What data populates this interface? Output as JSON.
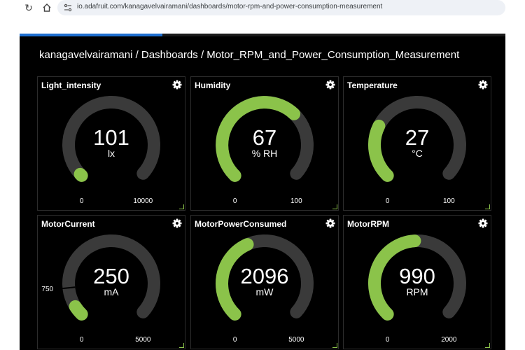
{
  "browser": {
    "url": "io.adafruit.com/kanagavelvairamani/dashboards/motor-rpm-and-power-consumption-measurement"
  },
  "page": {
    "breadcrumb": "kanagavelvairamani / Dashboards / Motor_RPM_and_Power_Consumption_Measurement"
  },
  "colors": {
    "accent": "#8bc34a",
    "track": "#3a3a3a",
    "background": "#000000"
  },
  "gauges": [
    {
      "title": "Light_intensity",
      "value": "101",
      "unit": "lx",
      "min": "0",
      "max": "10000",
      "fill": 0.0101
    },
    {
      "title": "Humidity",
      "value": "67",
      "unit": "% RH",
      "min": "0",
      "max": "100",
      "fill": 0.67
    },
    {
      "title": "Temperature",
      "value": "27",
      "unit": "°C",
      "min": "0",
      "max": "100",
      "fill": 0.27
    },
    {
      "title": "MotorCurrent",
      "value": "250",
      "unit": "mA",
      "min": "0",
      "max": "5000",
      "fill": 0.05,
      "threshold_label": "750",
      "threshold_fraction": 0.15
    },
    {
      "title": "MotorPowerConsumed",
      "value": "2096",
      "unit": "mW",
      "min": "0",
      "max": "5000",
      "fill": 0.4192
    },
    {
      "title": "MotorRPM",
      "value": "990",
      "unit": "RPM",
      "min": "0",
      "max": "2000",
      "fill": 0.495
    }
  ]
}
